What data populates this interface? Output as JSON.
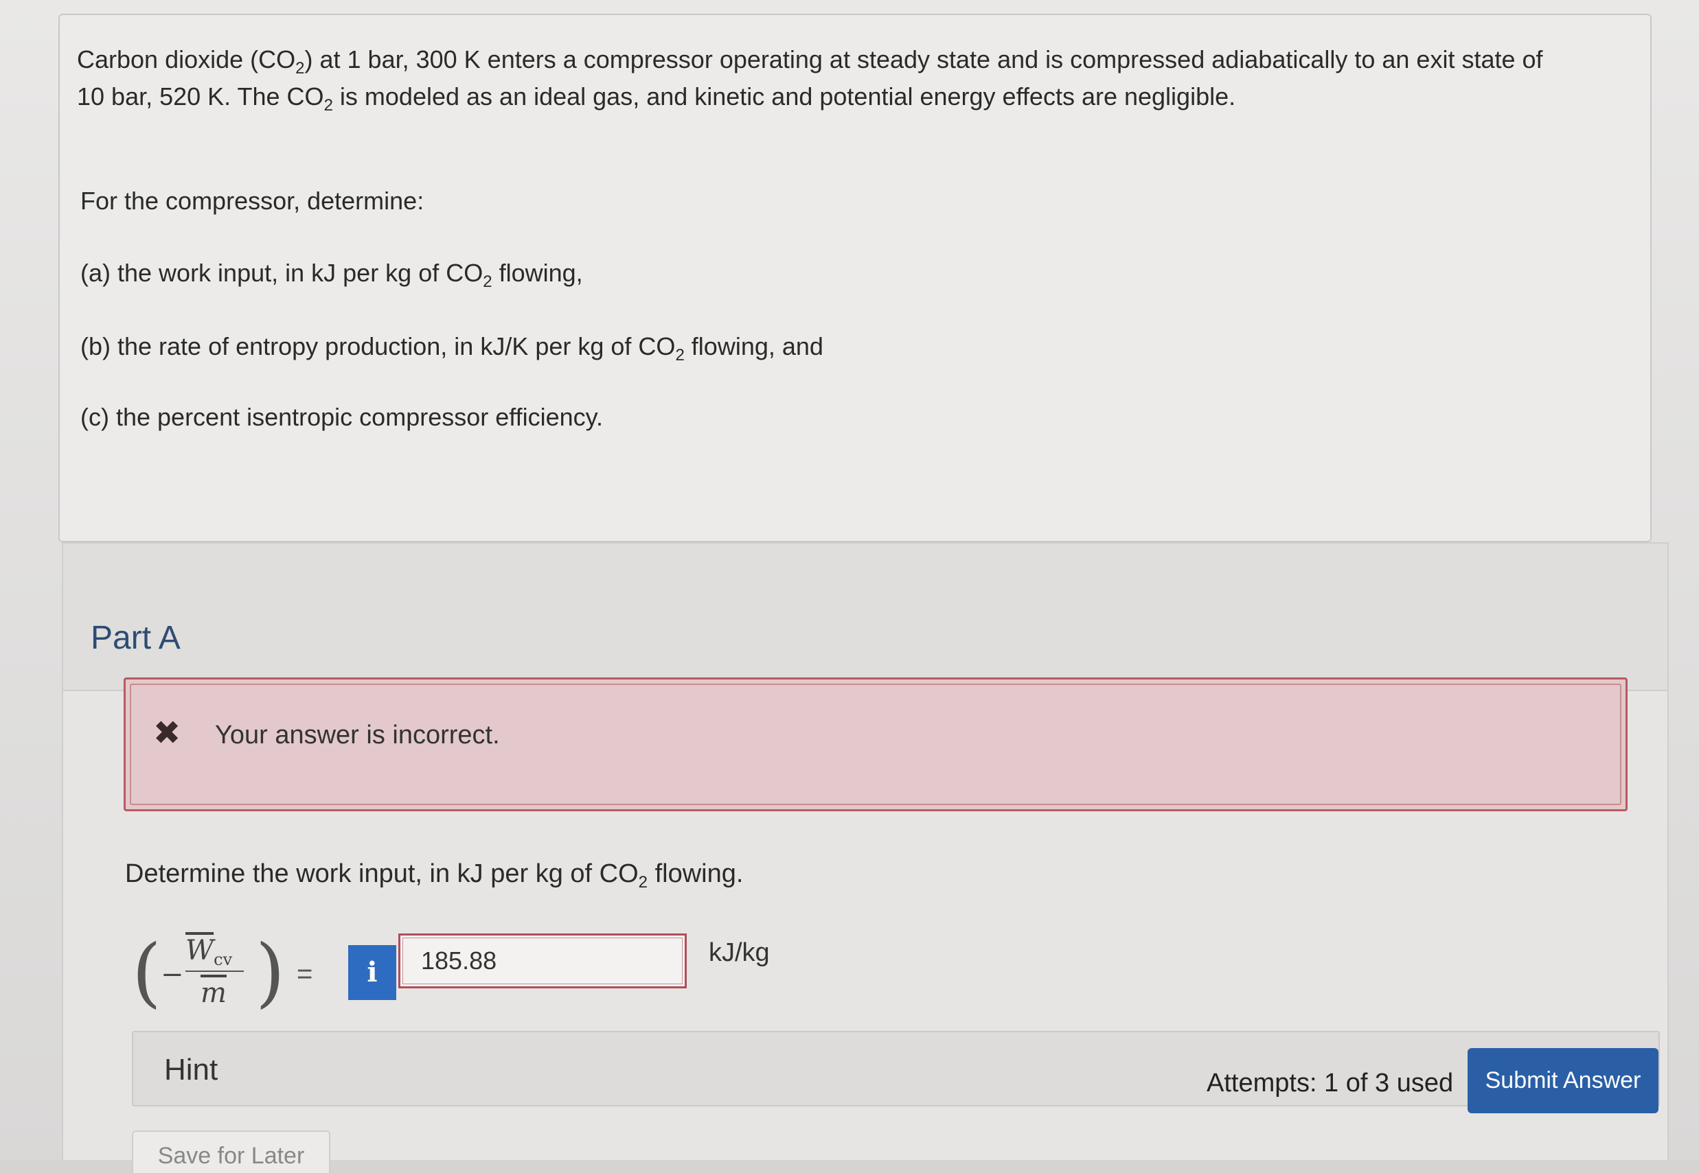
{
  "problem": {
    "statement_line1_a": "Carbon dioxide (CO",
    "statement_line1_sub": "2",
    "statement_line1_b": ") at 1 bar, 300 K enters a compressor operating at steady state and is compressed adiabatically to an exit state of",
    "statement_line2_a": "10 bar, 520 K. The CO",
    "statement_line2_sub": "2",
    "statement_line2_b": " is modeled as an ideal gas, and kinetic and potential energy effects are negligible.",
    "determine_intro": "For the compressor, determine:",
    "item_a_pre": "(a) the work input, in kJ per kg of CO",
    "item_a_sub": "2",
    "item_a_post": " flowing,",
    "item_b_pre": "(b) the rate of entropy production, in kJ/K per kg of CO",
    "item_b_sub": "2",
    "item_b_post": " flowing, and",
    "item_c": "(c) the percent isentropic compressor efficiency."
  },
  "part": {
    "title": "Part A",
    "feedback": "Your answer is incorrect.",
    "question_pre": "Determine the work input, in kJ per kg of CO",
    "question_sub": "2",
    "question_post": " flowing.",
    "formula_numerator": "W",
    "formula_numerator_sub": "cv",
    "formula_denominator": "m",
    "equals": "=",
    "info_icon_glyph": "i",
    "answer_value": "185.88",
    "unit": "kJ/kg",
    "hint_label": "Hint",
    "attempts": "Attempts: 1 of 3 used",
    "submit_label": "Submit Answer",
    "save_label": "Save for Later"
  },
  "colors": {
    "accent_blue": "#2a5fa6",
    "error_border": "#b75a62",
    "part_title": "#2d4c73"
  },
  "icons": {
    "error": "close-x-icon",
    "info": "info-icon"
  }
}
